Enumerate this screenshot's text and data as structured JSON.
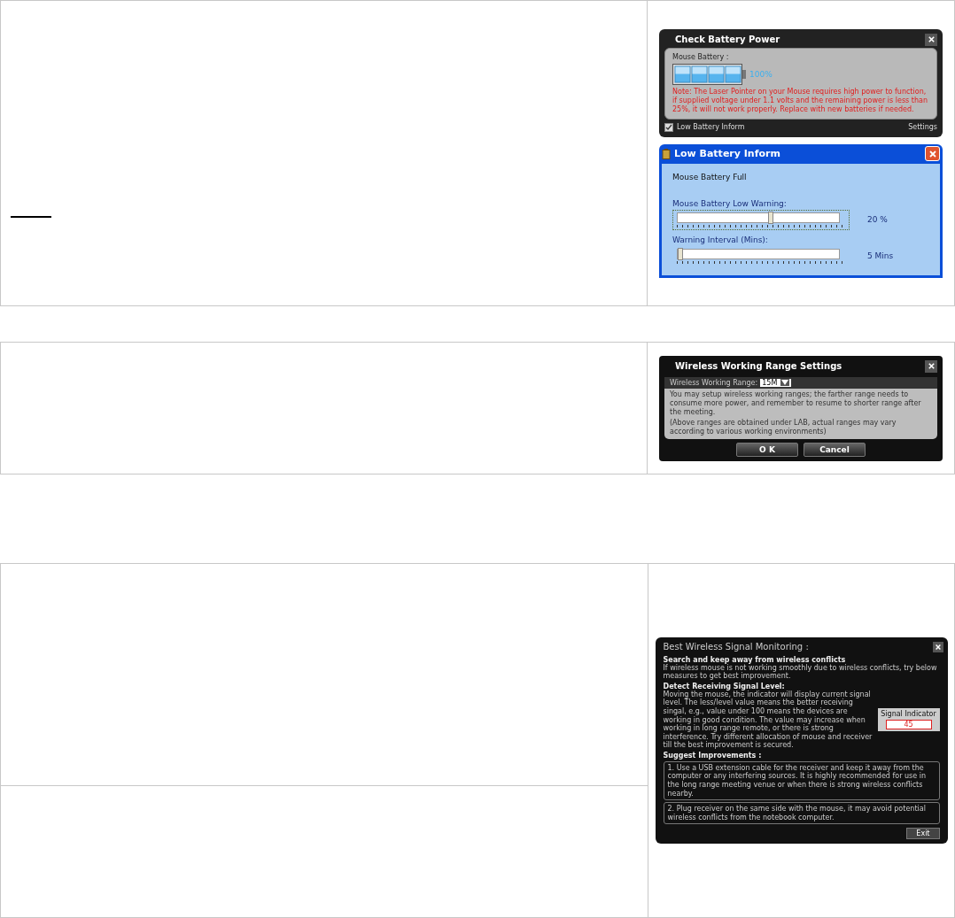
{
  "battery_dialog": {
    "title": "Check Battery Power",
    "label": "Mouse Battery :",
    "reading": "100%",
    "note": "Note: The Laser Pointer on your Mouse requires high power to function, if supplied voltage under 1.1 volts and the remaining power is less than 25%, it will not work properly. Replace with new batteries if needed.",
    "inform": {
      "label": "Low Battery Inform",
      "checked": true
    },
    "settings": "Settings"
  },
  "inform_dialog": {
    "title": "Low Battery Inform",
    "status": "Mouse Battery Full",
    "sliders": [
      {
        "label": "Mouse Battery Low Warning:",
        "level": 0.56,
        "reading": "20 %",
        "focused": true
      },
      {
        "label": "Warning Interval (Mins):",
        "level": 0.0,
        "reading": "5 Mins",
        "focused": false
      }
    ]
  },
  "range_dialog": {
    "title": "Wireless Working Range Settings",
    "field_label": "Wireless Working Range:",
    "value": "15M",
    "text": "You may setup wireless working ranges; the farther range needs to consume more power, and remember to resume to shorter range after the meeting.",
    "footnote": "(Above ranges are obtained under LAB, actual ranges may vary according to various working environments)",
    "buttons": [
      "O K",
      "Cancel"
    ]
  },
  "signal_dialog": {
    "title": "Best Wireless Signal Monitoring :",
    "sections": [
      {
        "heading": "Search and keep away from wireless conflicts",
        "text": "If wireless mouse is not working smoothly due to wireless conflicts, try below measures to get best improvement."
      },
      {
        "heading": "Detect Receiving Signal Level:",
        "text": "Moving the mouse, the indicator will display current signal level. The less/level value means the better receiving singal, e.g., value under 100 means the devices are working in good condition. The value may increase when working in long range remote, or there is strong interference. Try different allocation of mouse and receiver till the best improvement is secured."
      }
    ],
    "indicator": {
      "label": "Signal Indicator",
      "value": "45"
    },
    "suggest_heading": "Suggest Improvements :",
    "suggestions": [
      "1. Use a USB extension cable for the receiver and keep it away from the computer or any interfering sources. It is highly recommended for use in the long range meeting venue or when there is strong wireless conflicts nearby.",
      "2. Plug receiver on the same side with the mouse, it may avoid potential wireless conflicts from the notebook computer."
    ],
    "exit": "Exit"
  }
}
